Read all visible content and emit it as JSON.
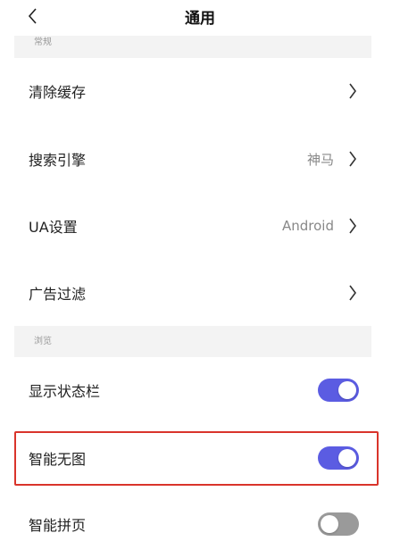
{
  "header": {
    "title": "通用"
  },
  "sections": {
    "general": "常规",
    "browse": "浏览"
  },
  "general_items": [
    {
      "label": "清除缓存",
      "value": ""
    },
    {
      "label": "搜索引擎",
      "value": "神马"
    },
    {
      "label": "UA设置",
      "value": "Android"
    },
    {
      "label": "广告过滤",
      "value": ""
    }
  ],
  "browse_items": [
    {
      "label": "显示状态栏",
      "enabled": true
    },
    {
      "label": "智能无图",
      "enabled": true
    },
    {
      "label": "智能拼页",
      "enabled": false
    }
  ],
  "colors": {
    "toggle_on": "#5b5ce2",
    "toggle_off": "#9a9a9a",
    "highlight": "#d9342b",
    "section_bg": "#f3f3f3"
  },
  "icons": {
    "back": "chevron-left-icon",
    "row_arrow": "chevron-right-icon"
  }
}
